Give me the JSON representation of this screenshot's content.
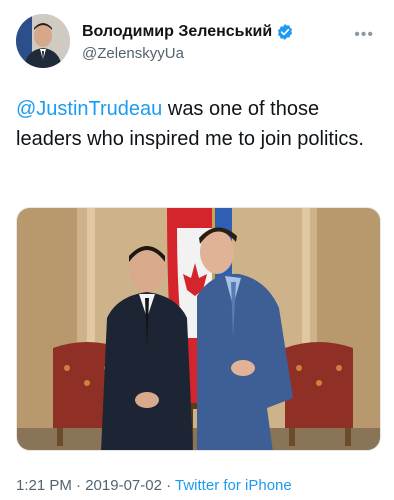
{
  "tweet": {
    "author": {
      "display_name": "Володимир Зеленський",
      "handle": "@ZelenskyyUa",
      "verified": true,
      "verified_color": "#1d9bf0"
    },
    "text": {
      "mention": "@JustinTrudeau",
      "body": " was one of those leaders who inspired me to join politics."
    },
    "media": {
      "type": "photo"
    },
    "meta": {
      "time": "1:21 PM",
      "separator_1": " · ",
      "date": "2019-07-02",
      "separator_2": " · ",
      "source": "Twitter for iPhone"
    },
    "icons": {
      "more": "more-horizontal-icon",
      "verified": "verified-badge-icon"
    },
    "colors": {
      "text": "#0f1419",
      "secondary": "#536471",
      "link": "#1d9bf0"
    }
  }
}
